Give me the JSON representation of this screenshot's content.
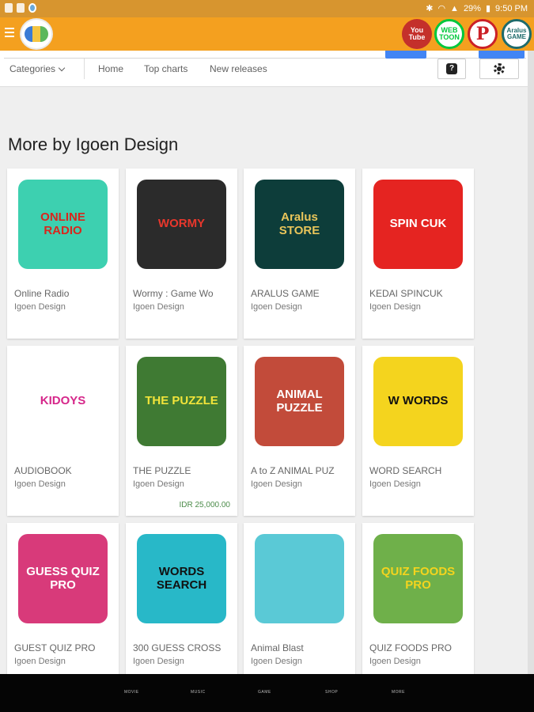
{
  "status_bar": {
    "battery": "29%",
    "time": "9:50 PM"
  },
  "app_bar": {
    "social": [
      {
        "name": "youtube",
        "label": "You Tube"
      },
      {
        "name": "webtoon",
        "label": "WEB TOON"
      },
      {
        "name": "pinterest",
        "label": "P"
      },
      {
        "name": "game-store",
        "label": "Aralus GAME"
      }
    ]
  },
  "nav": {
    "categories": "Categories",
    "home": "Home",
    "top_charts": "Top charts",
    "new_releases": "New releases",
    "help": "?"
  },
  "section_title": "More by Igoen Design",
  "apps": [
    {
      "title": "Online Radio",
      "developer": "Igoen Design",
      "icon_text": "ONLINE RADIO",
      "bg": "#3dd0b0",
      "fg": "#d9261c"
    },
    {
      "title": "Wormy : Game Wo",
      "developer": "Igoen Design",
      "icon_text": "WORMY",
      "bg": "#2b2b2b",
      "fg": "#e8372c"
    },
    {
      "title": "ARALUS GAME",
      "developer": "Igoen Design",
      "icon_text": "Aralus STORE",
      "bg": "#0d3d3a",
      "fg": "#e9c55a"
    },
    {
      "title": "KEDAI SPINCUK",
      "developer": "Igoen Design",
      "icon_text": "SPIN CUK",
      "bg": "#e52421",
      "fg": "#ffffff"
    },
    {
      "title": "AUDIOBOOK",
      "developer": "Igoen Design",
      "icon_text": "KIDOYS",
      "bg": "#ffffff",
      "fg": "#d6278a"
    },
    {
      "title": "THE PUZZLE",
      "developer": "Igoen Design",
      "icon_text": "THE PUZZLE",
      "bg": "#3f7a33",
      "fg": "#f2e43a",
      "price": "IDR 25,000.00"
    },
    {
      "title": "A to Z ANIMAL PUZ",
      "developer": "Igoen Design",
      "icon_text": "ANIMAL PUZZLE",
      "bg": "#c24b3a",
      "fg": "#ffffff"
    },
    {
      "title": "WORD SEARCH",
      "developer": "Igoen Design",
      "icon_text": "W WORDS",
      "bg": "#f4d41e",
      "fg": "#111111"
    },
    {
      "title": "GUEST QUIZ PRO",
      "developer": "Igoen Design",
      "icon_text": "GUESS QUIZ PRO",
      "bg": "#d83a7a",
      "fg": "#ffffff"
    },
    {
      "title": "300 GUESS CROSS",
      "developer": "Igoen Design",
      "icon_text": "WORDS SEARCH",
      "bg": "#28b8c8",
      "fg": "#111111"
    },
    {
      "title": "Animal Blast",
      "developer": "Igoen Design",
      "icon_text": "",
      "bg": "#5ac9d6",
      "fg": "#8a5a2b"
    },
    {
      "title": "QUIZ FOODS PRO",
      "developer": "Igoen Design",
      "icon_text": "QUIZ FOODS PRO",
      "bg": "#6fb04a",
      "fg": "#f4d41e"
    }
  ],
  "bottom_nav": [
    "MOVIE",
    "MUSIC",
    "GAME",
    "SHOP",
    "MORE"
  ]
}
